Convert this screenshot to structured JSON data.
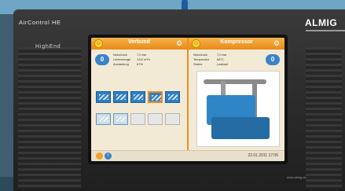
{
  "device": {
    "brand_line1": "AirControl HE",
    "brand_line2": "HighEnd",
    "logo": "ALMIG",
    "footer_url": "www.almig.de"
  },
  "screen": {
    "left_panel": {
      "title": "Verbund",
      "circle_value": "0",
      "kv": [
        {
          "k": "Netzdruck",
          "v": "7,0 bar"
        },
        {
          "k": "Liefermenge",
          "v": "13,8 m³/h"
        },
        {
          "k": "Auslastung",
          "v": "67%"
        }
      ],
      "tiles_row1_icons": [
        "compressor-icon",
        "compressor-icon",
        "compressor-icon",
        "compressor-icon",
        "compressor-icon"
      ],
      "tiles_row2_icons": [
        "compressor-icon",
        "compressor-icon",
        "empty-slot",
        "empty-slot",
        "empty-slot"
      ]
    },
    "right_panel": {
      "title": "Kompressor",
      "circle_value": "0",
      "kv": [
        {
          "k": "Netzdruck",
          "v": "7,0 bar"
        },
        {
          "k": "Temperatur",
          "v": "68°C"
        },
        {
          "k": "Status",
          "v": "Lastlauf"
        }
      ]
    },
    "status_bar": {
      "datetime": "22.01.2011 17:06"
    }
  },
  "colors": {
    "accent": "#f08c1c",
    "primary_blue": "#2e7fc4"
  }
}
